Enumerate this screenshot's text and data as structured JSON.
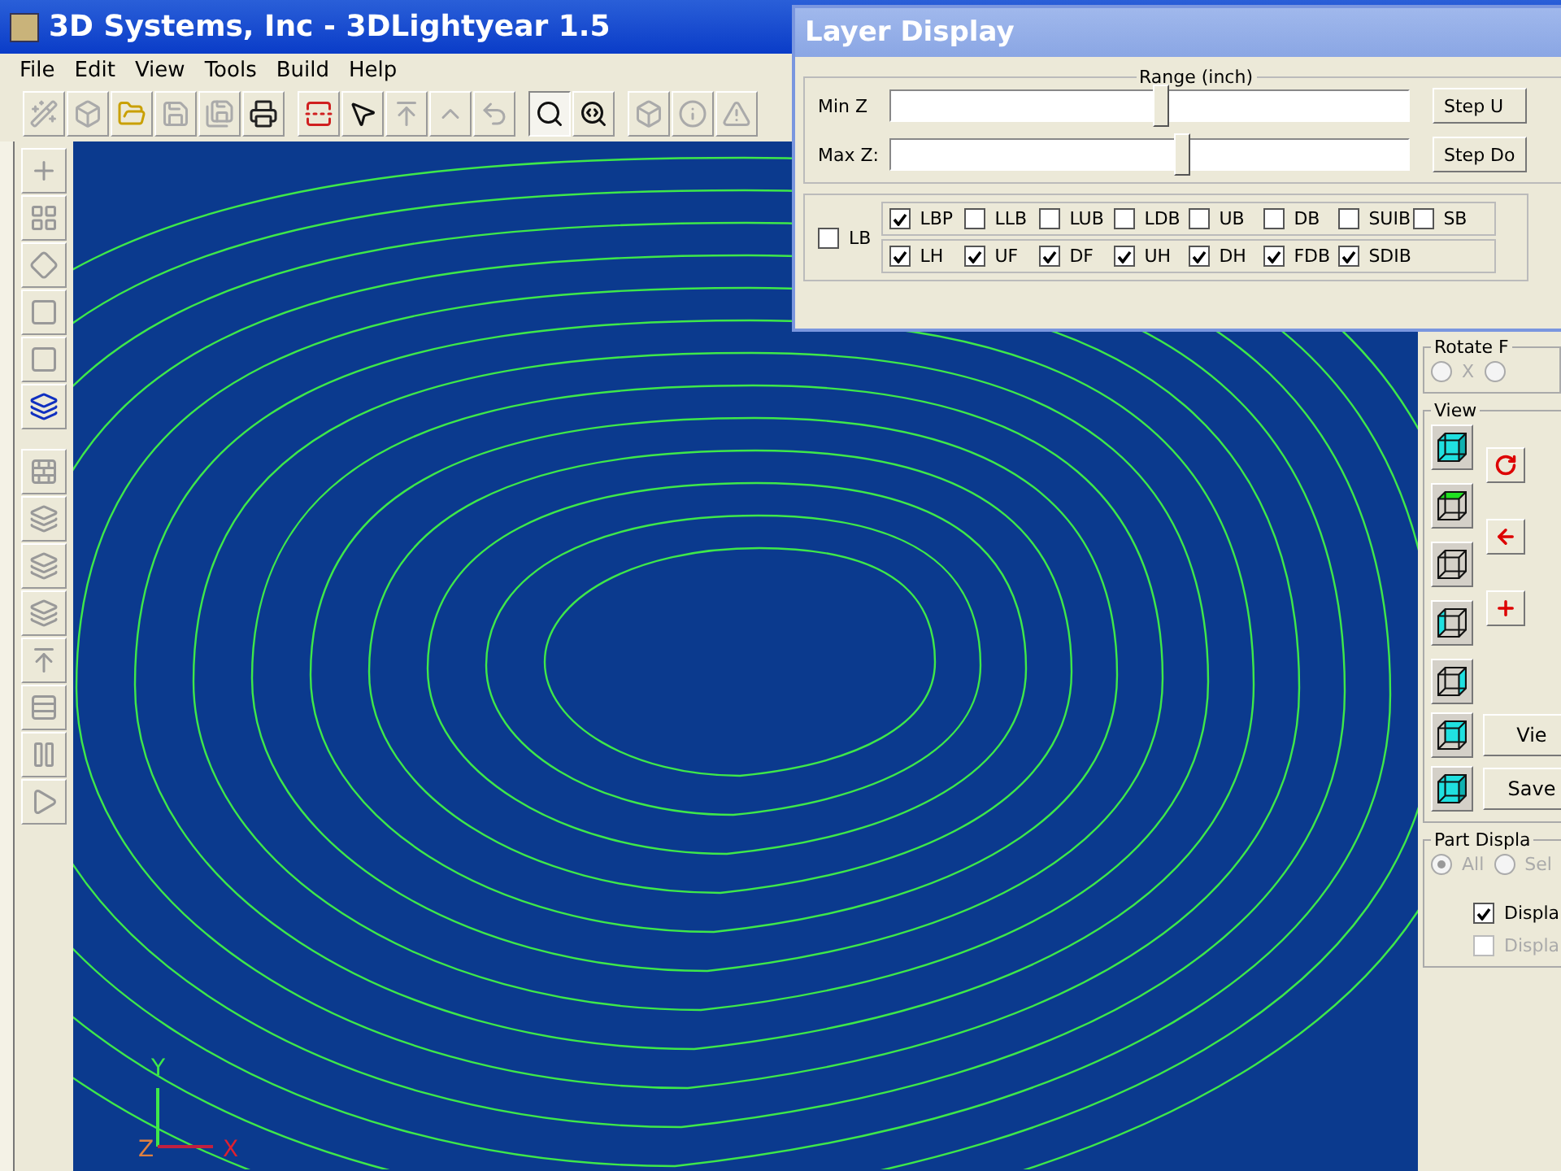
{
  "window": {
    "title": "3D Systems, Inc - 3DLightyear 1.5"
  },
  "menu": [
    "File",
    "Edit",
    "View",
    "Tools",
    "Build",
    "Help"
  ],
  "toolbar": [
    {
      "kind": "wand",
      "disabled": true,
      "selected": false
    },
    {
      "kind": "wire",
      "disabled": true,
      "selected": false
    },
    {
      "kind": "open",
      "disabled": false,
      "selected": false
    },
    {
      "kind": "save",
      "disabled": true,
      "selected": false
    },
    {
      "kind": "saveall",
      "disabled": true,
      "selected": false
    },
    {
      "kind": "print",
      "disabled": false,
      "selected": false
    },
    {
      "kind": "sep"
    },
    {
      "kind": "flip",
      "disabled": false,
      "selected": false
    },
    {
      "kind": "pointer",
      "disabled": false,
      "selected": false
    },
    {
      "kind": "lift",
      "disabled": true,
      "selected": false
    },
    {
      "kind": "up",
      "disabled": true,
      "selected": false
    },
    {
      "kind": "undo",
      "disabled": true,
      "selected": false
    },
    {
      "kind": "sep"
    },
    {
      "kind": "zoom",
      "disabled": false,
      "selected": true
    },
    {
      "kind": "zoomrot",
      "disabled": false,
      "selected": false
    },
    {
      "kind": "sep"
    },
    {
      "kind": "box",
      "disabled": true,
      "selected": false
    },
    {
      "kind": "info",
      "disabled": true,
      "selected": false
    },
    {
      "kind": "warn",
      "disabled": true,
      "selected": false
    }
  ],
  "side_toolbar": [
    {
      "kind": "plus",
      "disabled": true
    },
    {
      "kind": "grid",
      "disabled": true
    },
    {
      "kind": "shape",
      "disabled": true
    },
    {
      "kind": "square",
      "disabled": true
    },
    {
      "kind": "square",
      "disabled": true
    },
    {
      "kind": "stack",
      "disabled": false
    },
    {
      "kind": "sep"
    },
    {
      "kind": "wall",
      "disabled": true
    },
    {
      "kind": "layers",
      "disabled": true
    },
    {
      "kind": "layers",
      "disabled": true
    },
    {
      "kind": "layers",
      "disabled": true
    },
    {
      "kind": "lift",
      "disabled": true
    },
    {
      "kind": "rows",
      "disabled": true
    },
    {
      "kind": "pause",
      "disabled": true
    },
    {
      "kind": "play",
      "disabled": true
    }
  ],
  "axes": {
    "y": "Y",
    "z": "Z",
    "x": "X"
  },
  "layer_dialog": {
    "title": "Layer Display",
    "range_label": "Range (inch)",
    "sliders": [
      {
        "label": "Min Z",
        "level": 0.52,
        "button": "Step U"
      },
      {
        "label": "Max Z:",
        "level": 0.56,
        "button": "Step Do"
      }
    ],
    "lb": {
      "label": "LB",
      "checked": false
    },
    "rows": [
      [
        {
          "label": "LBP",
          "checked": true
        },
        {
          "label": "LLB",
          "checked": false
        },
        {
          "label": "LUB",
          "checked": false
        },
        {
          "label": "LDB",
          "checked": false
        },
        {
          "label": "UB",
          "checked": false
        },
        {
          "label": "DB",
          "checked": false
        },
        {
          "label": "SUIB",
          "checked": false
        },
        {
          "label": "SB",
          "checked": false
        }
      ],
      [
        {
          "label": "LH",
          "checked": true
        },
        {
          "label": "UF",
          "checked": true
        },
        {
          "label": "DF",
          "checked": true
        },
        {
          "label": "UH",
          "checked": true
        },
        {
          "label": "DH",
          "checked": true
        },
        {
          "label": "FDB",
          "checked": true
        },
        {
          "label": "SDIB",
          "checked": true
        }
      ]
    ]
  },
  "right_panel": {
    "rotate": {
      "label": "Rotate F",
      "radios": [
        {
          "label": "X",
          "selected": false
        },
        {
          "selected": false
        }
      ]
    },
    "view": {
      "label": "View",
      "cubes": [
        {
          "kind": "solid"
        },
        {
          "kind": "top"
        },
        {
          "kind": "wire"
        },
        {
          "kind": "left"
        },
        {
          "kind": "right"
        },
        {
          "kind": "front"
        },
        {
          "kind": "solid"
        }
      ],
      "nav": [
        {
          "kind": "rotate"
        },
        {
          "kind": "left"
        },
        {
          "kind": "add"
        }
      ],
      "buttons": [
        "Vie",
        "Save"
      ]
    },
    "part": {
      "label": "Part Displa",
      "radios": [
        {
          "label": "All",
          "selected": true
        },
        {
          "label": "Sel",
          "selected": false
        }
      ],
      "checks": [
        {
          "label": "Displa",
          "checked": true,
          "disabled": false
        },
        {
          "label": "Displa",
          "checked": false,
          "disabled": true
        }
      ]
    }
  }
}
